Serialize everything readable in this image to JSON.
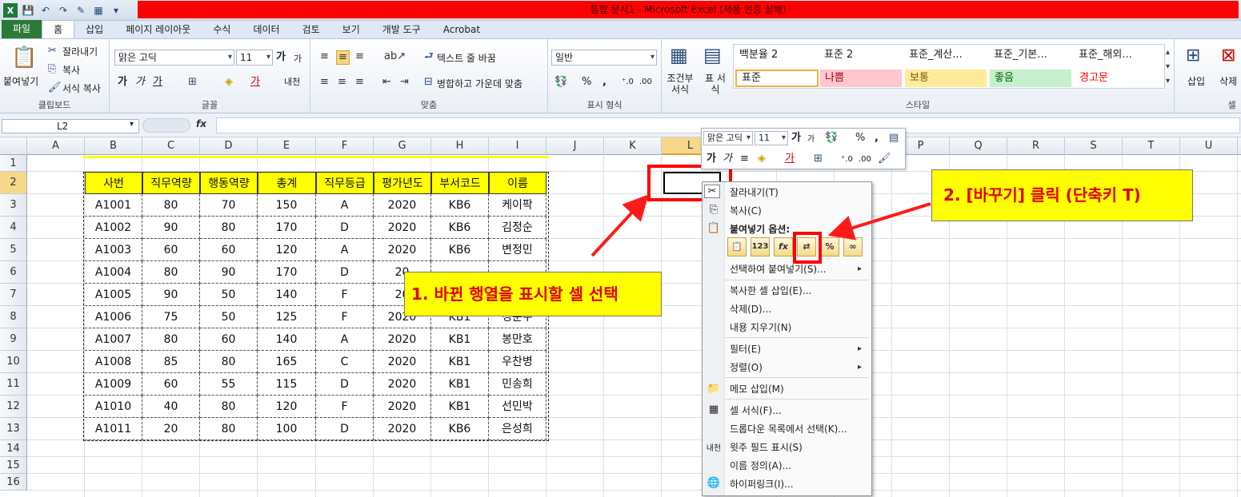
{
  "window": {
    "title": "통합 문서1  -  Microsoft Excel (제품 인증 실패)"
  },
  "tabs": [
    "파일",
    "홈",
    "삽입",
    "페이지 레이아웃",
    "수식",
    "데이터",
    "검토",
    "보기",
    "개발 도구",
    "Acrobat"
  ],
  "ribbon": {
    "clipboard": {
      "paste": "붙여넣기",
      "cut": "잘라내기",
      "copy": "복사",
      "format_painter": "서식 복사",
      "label": "클립보드"
    },
    "font": {
      "name": "맑은 고딕",
      "size": "11",
      "label": "글꼴"
    },
    "align": {
      "wrap": "텍스트 줄 바꿈",
      "merge": "병합하고 가운데 맞춤",
      "label": "맞춤"
    },
    "number": {
      "format": "일반",
      "label": "표시 형식"
    },
    "styles": {
      "conditional": "조건부 서식",
      "table": "표 서식",
      "row1": [
        "백분율 2",
        "표준 2",
        "표준_계산...",
        "표준_기본...",
        "표준_해외..."
      ],
      "row2": [
        "표준",
        "나쁨",
        "보통",
        "좋음",
        "경고문"
      ],
      "label": "스타일"
    },
    "cells": {
      "insert": "삽입",
      "delete": "삭제",
      "label": "셀"
    }
  },
  "formula_bar": {
    "name_box": "L2",
    "fx": "fx",
    "value": ""
  },
  "columns": [
    "A",
    "B",
    "C",
    "D",
    "E",
    "F",
    "G",
    "H",
    "I",
    "J",
    "K",
    "L",
    "M",
    "N",
    "O",
    "P",
    "Q",
    "R",
    "S",
    "T",
    "U"
  ],
  "rows": [
    "1",
    "2",
    "3",
    "4",
    "5",
    "6",
    "7",
    "8",
    "9",
    "10",
    "11",
    "12",
    "13",
    "14",
    "15",
    "16"
  ],
  "table": {
    "headers": [
      "사번",
      "직무역량",
      "행동역량",
      "총계",
      "직무등급",
      "평가년도",
      "부서코드",
      "이름"
    ],
    "rows": [
      [
        "A1001",
        "80",
        "70",
        "150",
        "A",
        "2020",
        "KB6",
        "케이팍"
      ],
      [
        "A1002",
        "90",
        "80",
        "170",
        "D",
        "2020",
        "KB6",
        "김정순"
      ],
      [
        "A1003",
        "60",
        "60",
        "120",
        "A",
        "2020",
        "KB6",
        "변정민"
      ],
      [
        "A1004",
        "80",
        "90",
        "170",
        "D",
        "20",
        "",
        ""
      ],
      [
        "A1005",
        "90",
        "50",
        "140",
        "F",
        "20",
        "",
        ""
      ],
      [
        "A1006",
        "75",
        "50",
        "125",
        "F",
        "2020",
        "KB1",
        "경준수"
      ],
      [
        "A1007",
        "80",
        "60",
        "140",
        "A",
        "2020",
        "KB1",
        "봉만호"
      ],
      [
        "A1008",
        "85",
        "80",
        "165",
        "C",
        "2020",
        "KB1",
        "우찬병"
      ],
      [
        "A1009",
        "60",
        "55",
        "115",
        "D",
        "2020",
        "KB1",
        "민송희"
      ],
      [
        "A1010",
        "40",
        "80",
        "120",
        "F",
        "2020",
        "KB1",
        "선민박"
      ],
      [
        "A1011",
        "20",
        "80",
        "100",
        "D",
        "2020",
        "KB6",
        "은성희"
      ]
    ]
  },
  "mini_toolbar": {
    "font": "맑은 고딕",
    "size": "11",
    "percent": "%",
    "comma": ","
  },
  "context_menu": {
    "items": [
      "잘라내기(T)",
      "복사(C)",
      "붙여넣기 옵션:",
      "선택하여 붙여넣기(S)...",
      "복사한 셀 삽입(E)...",
      "삭제(D)...",
      "내용 지우기(N)",
      "필터(E)",
      "정렬(O)",
      "메모 삽입(M)",
      "셀 서식(F)...",
      "드롭다운 목록에서 선택(K)...",
      "윗주 필드 표시(S)",
      "이름 정의(A)...",
      "하이퍼링크(I)..."
    ],
    "paste_options": [
      "📋",
      "123",
      "fx",
      "⇄",
      "%",
      "∞"
    ]
  },
  "callouts": {
    "step1": "1. 바뀐 행열을 표시할 셀 선택",
    "step2": "2. [바꾸기] 클릭 (단축키 T)"
  },
  "colors": {
    "callout_bg": "#ffff00",
    "callout_text": "#e00000",
    "highlight_box": "#ff0000",
    "file_tab": "#2a7a36"
  }
}
